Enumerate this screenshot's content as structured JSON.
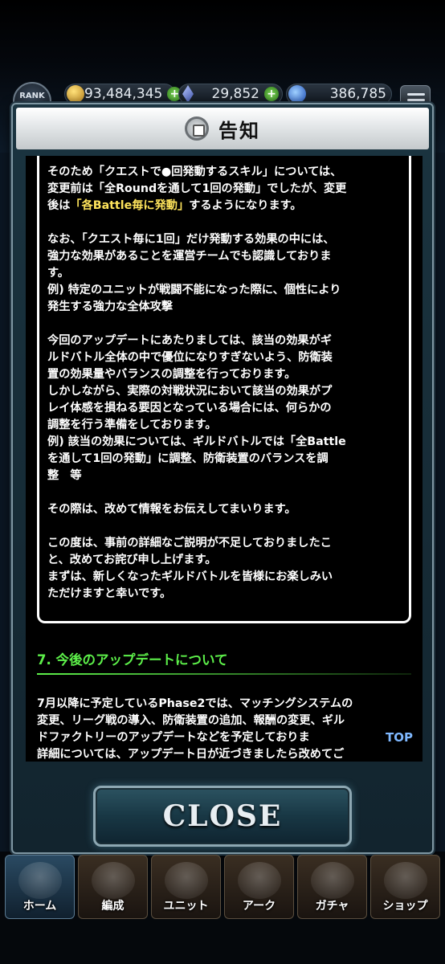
{
  "header": {
    "rank_label": "RANK",
    "gil": "93,484,345",
    "gems": "29,852",
    "orbs": "386,785"
  },
  "dialog": {
    "title": "告知",
    "paragraphs": [
      {
        "lines": [
          "そのため「クエストで●回発動するスキル」については、",
          "変更前は「全Roundを通して1回の発動」でしたが、変更",
          "後は"
        ],
        "highlight": "「各Battle毎に発動」",
        "after_highlight": "するようになります。"
      },
      {
        "lines": [
          "なお、「クエスト毎に1回」だけ発動する効果の中には、",
          "強力な効果があることを運営チームでも認識しておりま",
          "す。",
          "例) 特定のユニットが戦闘不能になった際に、個性により",
          "発生する強力な全体攻撃"
        ]
      },
      {
        "lines": [
          "今回のアップデートにあたりましては、該当の効果がギ",
          "ルドバトル全体の中で優位になりすぎないよう、防衛装",
          "置の効果量やバランスの調整を行っております。",
          "しかしながら、実際の対戦状況において該当の効果がプ",
          "レイ体感を損ねる要因となっている場合には、何らかの",
          "調整を行う準備をしております。",
          "例) 該当の効果については、ギルドバトルでは「全Battle",
          "を通して1回の発動」に調整、防衛装置のバランスを調",
          "整　等"
        ]
      },
      {
        "lines": [
          "その際は、改めて情報をお伝えしてまいります。"
        ]
      },
      {
        "lines": [
          "この度は、事前の詳細なご説明が不足しておりましたこ",
          "と、改めてお詫び申し上げます。",
          "まずは、新しくなったギルドバトルを皆様にお楽しみい",
          "ただけますと幸いです。"
        ]
      }
    ],
    "section_heading": "7. 今後のアップデートについて",
    "section_lines": [
      "7月以降に予定しているPhase2では、マッチングシステムの",
      "変更、リーグ戦の導入、防衛装置の追加、報酬の変更、ギル",
      "ドファクトリーのアップデートなどを予定しておりま",
      "詳細については、アップデート日が近づきましたら改めてご"
    ],
    "top_link": "TOP",
    "close_label": "CLOSE"
  },
  "nav": {
    "items": [
      "ホーム",
      "編成",
      "ユニット",
      "アーク",
      "ガチャ",
      "ショップ"
    ]
  }
}
